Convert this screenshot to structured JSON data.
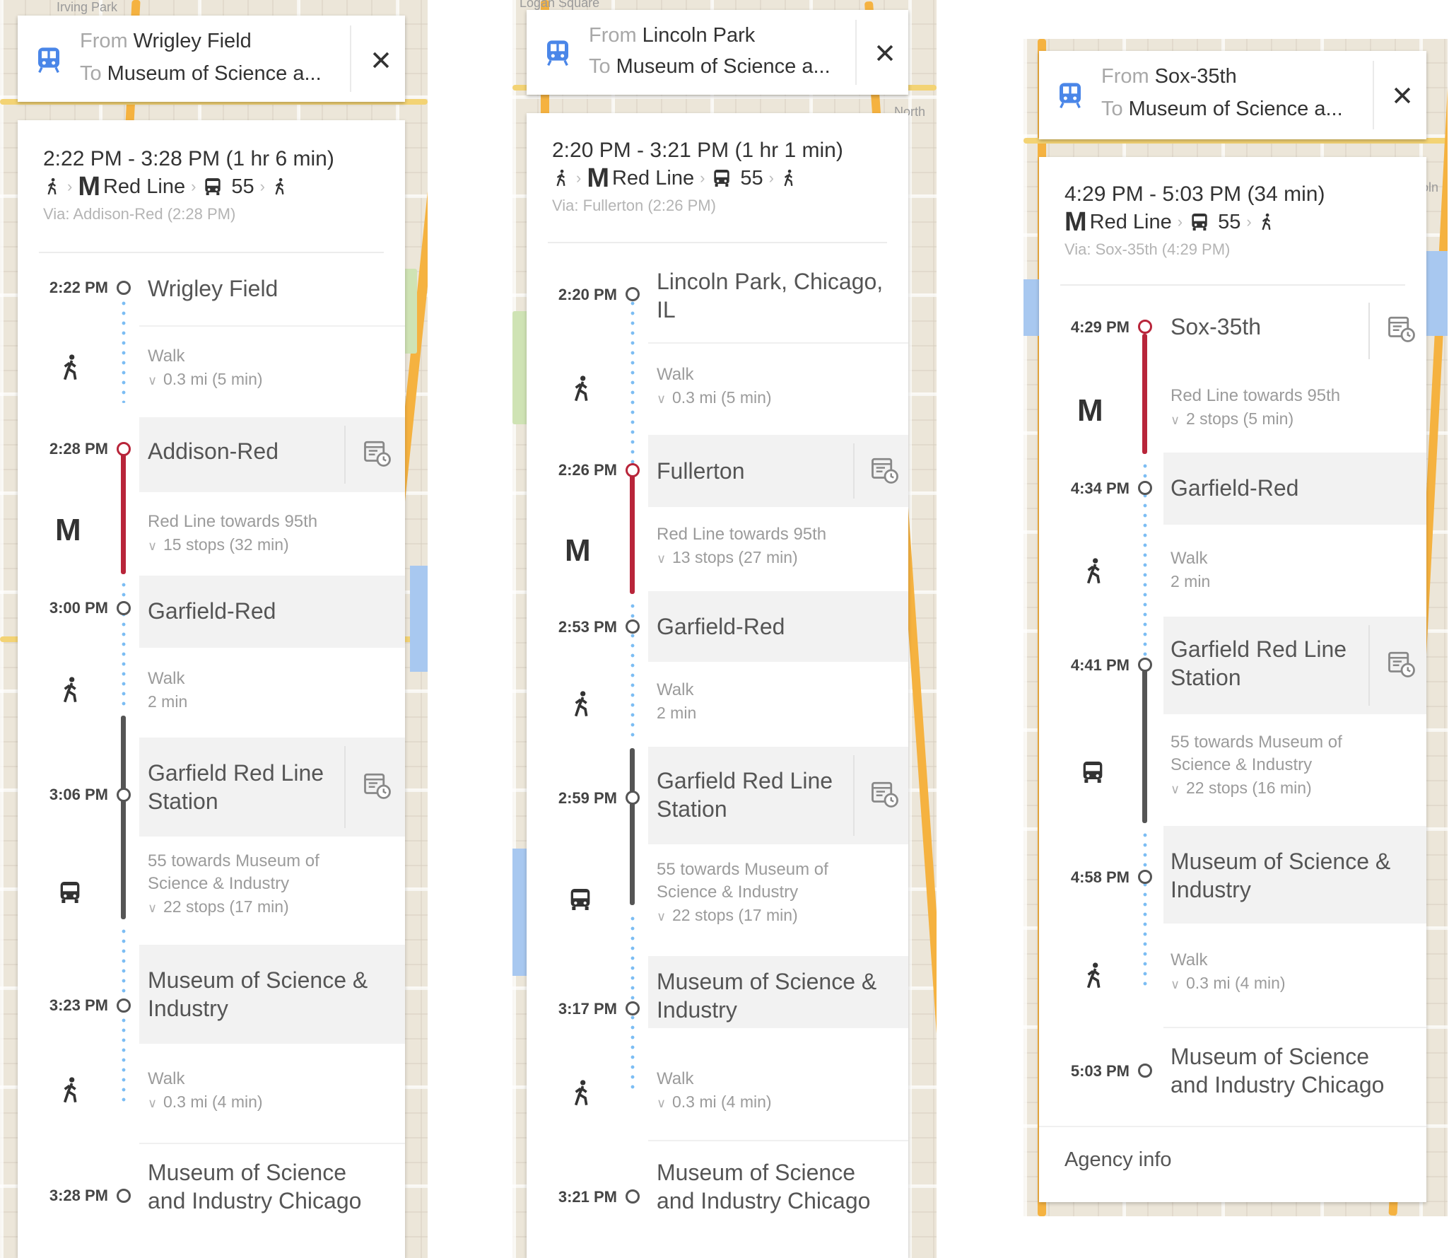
{
  "panels": [
    {
      "header": {
        "from_label": "From",
        "from": "Wrigley Field",
        "to_label": "To",
        "to": "Museum of Science a..."
      },
      "summary": {
        "time": "2:22 PM - 3:28 PM (1 hr 6 min)",
        "line": "Red Line",
        "bus": "55",
        "via": "Via: Addison-Red (2:28 PM)"
      },
      "stops": [
        {
          "time": "2:22 PM",
          "name": "Wrigley Field"
        },
        {
          "time": "2:28 PM",
          "name": "Addison-Red"
        },
        {
          "time": "3:00 PM",
          "name": "Garfield-Red"
        },
        {
          "time": "3:06 PM",
          "name": "Garfield Red Line Station"
        },
        {
          "time": "3:23 PM",
          "name": "Museum of Science & Industry"
        },
        {
          "time": "3:28 PM",
          "name": "Museum of Science and Industry Chicago"
        }
      ],
      "steps": [
        {
          "mode": "walk",
          "line1": "Walk",
          "line2": "0.3 mi (5 min)"
        },
        {
          "mode": "metro",
          "line1": "Red Line towards 95th",
          "line2": "15 stops (32 min)"
        },
        {
          "mode": "walk",
          "line1": "Walk",
          "line2": "2 min"
        },
        {
          "mode": "bus",
          "line1": "55 towards Museum of",
          "line1b": "Science & Industry",
          "line2": "22 stops (17 min)"
        },
        {
          "mode": "walk",
          "line1": "Walk",
          "line2": "0.3 mi (4 min)"
        }
      ]
    },
    {
      "header": {
        "from_label": "From",
        "from": "Lincoln Park",
        "to_label": "To",
        "to": "Museum of Science a..."
      },
      "summary": {
        "time": "2:20 PM - 3:21 PM (1 hr 1 min)",
        "line": "Red Line",
        "bus": "55",
        "via": "Via: Fullerton (2:26 PM)"
      },
      "stops": [
        {
          "time": "2:20 PM",
          "name": "Lincoln Park, Chicago, IL"
        },
        {
          "time": "2:26 PM",
          "name": "Fullerton"
        },
        {
          "time": "2:53 PM",
          "name": "Garfield-Red"
        },
        {
          "time": "2:59 PM",
          "name": "Garfield Red Line Station"
        },
        {
          "time": "3:17 PM",
          "name": "Museum of Science & Industry"
        },
        {
          "time": "3:21 PM",
          "name": "Museum of Science and Industry Chicago"
        }
      ],
      "steps": [
        {
          "mode": "walk",
          "line1": "Walk",
          "line2": "0.3 mi (5 min)"
        },
        {
          "mode": "metro",
          "line1": "Red Line towards 95th",
          "line2": "13 stops (27 min)"
        },
        {
          "mode": "walk",
          "line1": "Walk",
          "line2": "2 min"
        },
        {
          "mode": "bus",
          "line1": "55 towards Museum of",
          "line1b": "Science & Industry",
          "line2": "22 stops (17 min)"
        },
        {
          "mode": "walk",
          "line1": "Walk",
          "line2": "0.3 mi (4 min)"
        }
      ]
    },
    {
      "header": {
        "from_label": "From",
        "from": "Sox-35th",
        "to_label": "To",
        "to": "Museum of Science a..."
      },
      "summary": {
        "time": "4:29 PM - 5:03 PM (34 min)",
        "line": "Red Line",
        "bus": "55",
        "via": "Via: Sox-35th (4:29 PM)"
      },
      "stops": [
        {
          "time": "4:29 PM",
          "name": "Sox-35th"
        },
        {
          "time": "4:34 PM",
          "name": "Garfield-Red"
        },
        {
          "time": "4:41 PM",
          "name": "Garfield Red Line Station"
        },
        {
          "time": "4:58 PM",
          "name": "Museum of Science & Industry"
        },
        {
          "time": "5:03 PM",
          "name": "Museum of Science and Industry Chicago"
        }
      ],
      "steps": [
        {
          "mode": "metro",
          "line1": "Red Line towards 95th",
          "line2": "2 stops (5 min)"
        },
        {
          "mode": "walk",
          "line1": "Walk",
          "line2": "2 min"
        },
        {
          "mode": "bus",
          "line1": "55 towards Museum of",
          "line1b": "Science & Industry",
          "line2": "22 stops (16 min)"
        },
        {
          "mode": "walk",
          "line1": "Walk",
          "line2": "0.3 mi (4 min)"
        }
      ],
      "agency": "Agency info"
    }
  ],
  "map_labels": [
    "Irving Park",
    "Logan Square",
    "North",
    "Lincoln"
  ],
  "colors": {
    "red_line": "#b8253a",
    "bus_line": "#555555",
    "walk_dots": "#7cbdf3",
    "transit_icon": "#4a86e8"
  }
}
